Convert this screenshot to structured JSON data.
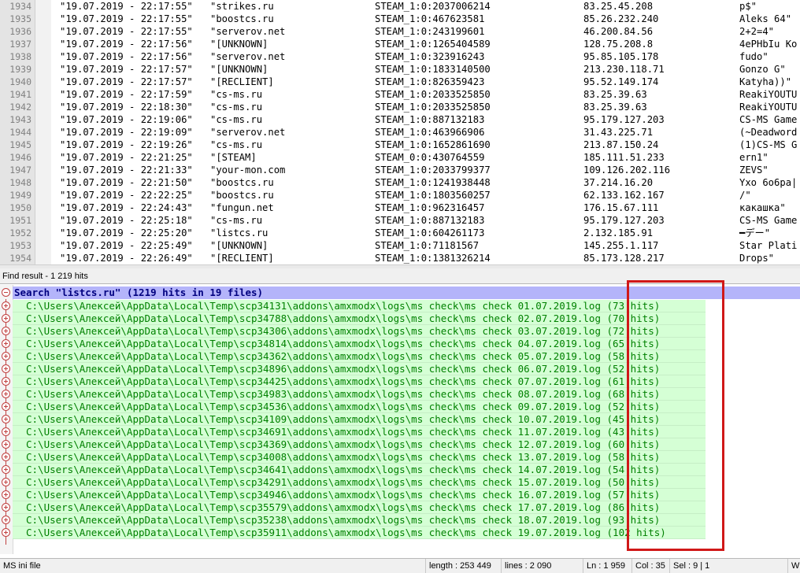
{
  "editor": {
    "lines": [
      {
        "num": "1934",
        "date": "\"19.07.2019 - 22:17:55\"",
        "server": "\"strikes.ru",
        "steam": "STEAM_1:0:2037006214",
        "ip": "83.25.45.208",
        "name": "p$\""
      },
      {
        "num": "1935",
        "date": "\"19.07.2019 - 22:17:55\"",
        "server": "\"boostcs.ru",
        "steam": "STEAM_1:0:467623581",
        "ip": "85.26.232.240",
        "name": "Aleks 64\""
      },
      {
        "num": "1936",
        "date": "\"19.07.2019 - 22:17:55\"",
        "server": "\"serverov.net",
        "steam": "STEAM_1:0:243199601",
        "ip": "46.200.84.56",
        "name": "2+2=4\""
      },
      {
        "num": "1937",
        "date": "\"19.07.2019 - 22:17:56\"",
        "server": "\"[UNKNOWN]",
        "steam": "STEAM_1:0:1265404589",
        "ip": "128.75.208.8",
        "name": "4ePHbIu Ko"
      },
      {
        "num": "1938",
        "date": "\"19.07.2019 - 22:17:56\"",
        "server": "\"serverov.net",
        "steam": "STEAM_1:0:323916243",
        "ip": "95.85.105.178",
        "name": "fudo\""
      },
      {
        "num": "1939",
        "date": "\"19.07.2019 - 22:17:57\"",
        "server": "\"[UNKNOWN]",
        "steam": "STEAM_1:0:1833140500",
        "ip": "213.230.118.71",
        "name": "Gonzo G\""
      },
      {
        "num": "1940",
        "date": "\"19.07.2019 - 22:17:57\"",
        "server": "\"[RECLIENT]",
        "steam": "STEAM_1:0:826359423",
        "ip": "95.52.149.174",
        "name": "Katyha))\""
      },
      {
        "num": "1941",
        "date": "\"19.07.2019 - 22:17:59\"",
        "server": "\"cs-ms.ru",
        "steam": "STEAM_1:0:2033525850",
        "ip": "83.25.39.63",
        "name": "ReakiYOUTU"
      },
      {
        "num": "1942",
        "date": "\"19.07.2019 - 22:18:30\"",
        "server": "\"cs-ms.ru",
        "steam": "STEAM_1:0:2033525850",
        "ip": "83.25.39.63",
        "name": "ReakiYOUTU"
      },
      {
        "num": "1943",
        "date": "\"19.07.2019 - 22:19:06\"",
        "server": "\"cs-ms.ru",
        "steam": "STEAM_1:0:887132183",
        "ip": "95.179.127.203",
        "name": "CS-MS Game"
      },
      {
        "num": "1944",
        "date": "\"19.07.2019 - 22:19:09\"",
        "server": "\"serverov.net",
        "steam": "STEAM_1:0:463966906",
        "ip": "31.43.225.71",
        "name": "(~Deadword"
      },
      {
        "num": "1945",
        "date": "\"19.07.2019 - 22:19:26\"",
        "server": "\"cs-ms.ru",
        "steam": "STEAM_1:0:1652861690",
        "ip": "213.87.150.24",
        "name": "(1)CS-MS G"
      },
      {
        "num": "1946",
        "date": "\"19.07.2019 - 22:21:25\"",
        "server": "\"[STEAM]",
        "steam": "STEAM_0:0:430764559",
        "ip": "185.111.51.233",
        "name": "ern1\""
      },
      {
        "num": "1947",
        "date": "\"19.07.2019 - 22:21:33\"",
        "server": "\"your-mon.com",
        "steam": "STEAM_1:0:2033799377",
        "ip": "109.126.202.116",
        "name": "ZEVS\""
      },
      {
        "num": "1948",
        "date": "\"19.07.2019 - 22:21:50\"",
        "server": "\"boostcs.ru",
        "steam": "STEAM_1:0:1241938448",
        "ip": "37.214.16.20",
        "name": "Yxo 6o6pa|"
      },
      {
        "num": "1949",
        "date": "\"19.07.2019 - 22:22:25\"",
        "server": "\"boostcs.ru",
        "steam": "STEAM_1:0:1803560257",
        "ip": "62.133.162.167",
        "name": "/\""
      },
      {
        "num": "1950",
        "date": "\"19.07.2019 - 22:24:43\"",
        "server": "\"fungun.net",
        "steam": "STEAM_1:0:962316457",
        "ip": "176.15.67.111",
        "name": "какашка\""
      },
      {
        "num": "1951",
        "date": "\"19.07.2019 - 22:25:18\"",
        "server": "\"cs-ms.ru",
        "steam": "STEAM_1:0:887132183",
        "ip": "95.179.127.203",
        "name": "CS-MS Game"
      },
      {
        "num": "1952",
        "date": "\"19.07.2019 - 22:25:20\"",
        "server": "\"listcs.ru",
        "steam": "STEAM_1:0:604261173",
        "ip": "2.132.185.91",
        "name": "━デー\""
      },
      {
        "num": "1953",
        "date": "\"19.07.2019 - 22:25:49\"",
        "server": "\"[UNKNOWN]",
        "steam": "STEAM_1:0:71181567",
        "ip": "145.255.1.117",
        "name": "Star Plati"
      },
      {
        "num": "1954",
        "date": "\"19.07.2019 - 22:26:49\"",
        "server": "\"[RECLIENT]",
        "steam": "STEAM_1:0:1381326214",
        "ip": "85.173.128.217",
        "name": "Drops\""
      }
    ]
  },
  "find_panel": {
    "title": "Find result - 1 219 hits",
    "search_header": "Search \"listcs.ru\" (1219 hits in 19 files)",
    "results": [
      "C:\\Users\\Алексей\\AppData\\Local\\Temp\\scp34131\\addons\\amxmodx\\logs\\ms check\\ms check 01.07.2019.log (73 hits)",
      "C:\\Users\\Алексей\\AppData\\Local\\Temp\\scp34788\\addons\\amxmodx\\logs\\ms check\\ms check 02.07.2019.log (70 hits)",
      "C:\\Users\\Алексей\\AppData\\Local\\Temp\\scp34306\\addons\\amxmodx\\logs\\ms check\\ms check 03.07.2019.log (72 hits)",
      "C:\\Users\\Алексей\\AppData\\Local\\Temp\\scp34814\\addons\\amxmodx\\logs\\ms check\\ms check 04.07.2019.log (65 hits)",
      "C:\\Users\\Алексей\\AppData\\Local\\Temp\\scp34362\\addons\\amxmodx\\logs\\ms check\\ms check 05.07.2019.log (58 hits)",
      "C:\\Users\\Алексей\\AppData\\Local\\Temp\\scp34896\\addons\\amxmodx\\logs\\ms check\\ms check 06.07.2019.log (52 hits)",
      "C:\\Users\\Алексей\\AppData\\Local\\Temp\\scp34425\\addons\\amxmodx\\logs\\ms check\\ms check 07.07.2019.log (61 hits)",
      "C:\\Users\\Алексей\\AppData\\Local\\Temp\\scp34983\\addons\\amxmodx\\logs\\ms check\\ms check 08.07.2019.log (68 hits)",
      "C:\\Users\\Алексей\\AppData\\Local\\Temp\\scp34536\\addons\\amxmodx\\logs\\ms check\\ms check 09.07.2019.log (52 hits)",
      "C:\\Users\\Алексей\\AppData\\Local\\Temp\\scp34109\\addons\\amxmodx\\logs\\ms check\\ms check 10.07.2019.log (45 hits)",
      "C:\\Users\\Алексей\\AppData\\Local\\Temp\\scp34691\\addons\\amxmodx\\logs\\ms check\\ms check 11.07.2019.log (43 hits)",
      "C:\\Users\\Алексей\\AppData\\Local\\Temp\\scp34369\\addons\\amxmodx\\logs\\ms check\\ms check 12.07.2019.log (60 hits)",
      "C:\\Users\\Алексей\\AppData\\Local\\Temp\\scp34008\\addons\\amxmodx\\logs\\ms check\\ms check 13.07.2019.log (58 hits)",
      "C:\\Users\\Алексей\\AppData\\Local\\Temp\\scp34641\\addons\\amxmodx\\logs\\ms check\\ms check 14.07.2019.log (54 hits)",
      "C:\\Users\\Алексей\\AppData\\Local\\Temp\\scp34291\\addons\\amxmodx\\logs\\ms check\\ms check 15.07.2019.log (50 hits)",
      "C:\\Users\\Алексей\\AppData\\Local\\Temp\\scp34946\\addons\\amxmodx\\logs\\ms check\\ms check 16.07.2019.log (57 hits)",
      "C:\\Users\\Алексей\\AppData\\Local\\Temp\\scp35579\\addons\\amxmodx\\logs\\ms check\\ms check 17.07.2019.log (86 hits)",
      "C:\\Users\\Алексей\\AppData\\Local\\Temp\\scp35238\\addons\\amxmodx\\logs\\ms check\\ms check 18.07.2019.log (93 hits)",
      "C:\\Users\\Алексей\\AppData\\Local\\Temp\\scp35911\\addons\\amxmodx\\logs\\ms check\\ms check 19.07.2019.log (102 hits)"
    ]
  },
  "statusbar": {
    "language": "MS ini file",
    "length": "length : 253 449",
    "lines": "lines : 2 090",
    "ln": "Ln : 1 959",
    "col": "Col : 35",
    "sel": "Sel : 9 | 1",
    "eol": "W"
  },
  "colors": {
    "search_header_bg": "#b4b4fa",
    "result_bg": "#d5ffd5",
    "result_text": "#008000",
    "highlight": "#d01818"
  },
  "icons": {
    "fold": "fold-collapse-icon",
    "expand": "fold-expand-icon"
  }
}
